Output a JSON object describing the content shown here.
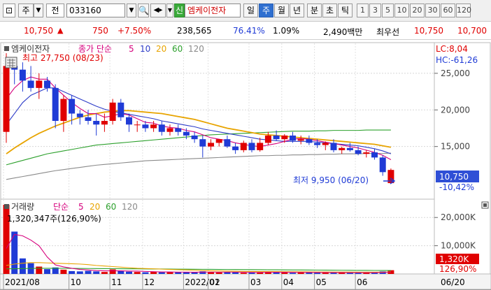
{
  "toolbar": {
    "type_label": "주",
    "field_label": "전",
    "code": "033160",
    "stock_name": "엠케이전자",
    "credit_label": "신",
    "periods": [
      "일",
      "주",
      "월",
      "년",
      "분",
      "초",
      "틱"
    ],
    "active_period": "주",
    "intervals": [
      "1",
      "3",
      "5",
      "10",
      "20",
      "30",
      "60",
      "120"
    ]
  },
  "quote": {
    "price": "10,750",
    "change": "750",
    "change_pct": "+7.50%",
    "volume": "238,565",
    "vol_ratio": "76.41%",
    "turnover": "1.09%",
    "amount": "2,490백만",
    "preferred_label": "최우선",
    "ask": "10,750",
    "bid": "10,700"
  },
  "colors": {
    "up": "#e00000",
    "down": "#1f3bd6",
    "ma5": "#d6007c",
    "ma10": "#2d3cc8",
    "ma20": "#e8a400",
    "ma60": "#2ca02c",
    "ma120": "#8a8a8a",
    "vol_up": "#e00000",
    "vol_down": "#1f3bd6"
  },
  "price_panel": {
    "legend_name": "엠케이전자",
    "legend_series": [
      "종가 단순",
      "5",
      "10",
      "20",
      "60",
      "120"
    ],
    "high_label": "최고 27,750 (08/23)",
    "low_label": "최저 9,950 (06/20)",
    "lc_label": "LC:8,04",
    "hc_label": "HC:-61,26",
    "axis_ticks": [
      "25,000",
      "20,000",
      "15,000"
    ],
    "last_price": "10,750",
    "last_change": "-10,42%"
  },
  "volume_panel": {
    "legend_title": "거래량",
    "legend_series": [
      "단순",
      "5",
      "20",
      "60",
      "120"
    ],
    "last_label": "1,320,347주(126,90%)",
    "axis_ticks": [
      "20,000K",
      "10,000K"
    ],
    "last_value": "1,320K",
    "last_pct": "126,90%"
  },
  "x_axis": {
    "labels": [
      "2021/08",
      "10",
      "11",
      "12",
      "2022/01",
      "02",
      "03",
      "04",
      "05",
      "06"
    ],
    "cursor_label": "06/20"
  },
  "chart_data": {
    "type": "candlestick",
    "period": "weekly",
    "price_ylim": [
      8000,
      29000
    ],
    "candles": [
      {
        "o": 17000,
        "h": 27750,
        "l": 15500,
        "c": 26000
      },
      {
        "o": 26000,
        "h": 27200,
        "l": 23500,
        "c": 25500
      },
      {
        "o": 25500,
        "h": 26500,
        "l": 22500,
        "c": 24000
      },
      {
        "o": 24000,
        "h": 26000,
        "l": 22500,
        "c": 23000
      },
      {
        "o": 23000,
        "h": 25000,
        "l": 21500,
        "c": 24000
      },
      {
        "o": 24000,
        "h": 24500,
        "l": 22500,
        "c": 23000
      },
      {
        "o": 23000,
        "h": 23500,
        "l": 17500,
        "c": 18500
      },
      {
        "o": 18500,
        "h": 22000,
        "l": 17000,
        "c": 21500
      },
      {
        "o": 21500,
        "h": 22000,
        "l": 18000,
        "c": 19500
      },
      {
        "o": 19500,
        "h": 20000,
        "l": 18000,
        "c": 19000
      },
      {
        "o": 19000,
        "h": 20000,
        "l": 18000,
        "c": 18500
      },
      {
        "o": 18500,
        "h": 19500,
        "l": 16500,
        "c": 18000
      },
      {
        "o": 18000,
        "h": 19500,
        "l": 17000,
        "c": 18500
      },
      {
        "o": 18500,
        "h": 21500,
        "l": 18000,
        "c": 21000
      },
      {
        "o": 21000,
        "h": 21500,
        "l": 18500,
        "c": 19000
      },
      {
        "o": 19000,
        "h": 19500,
        "l": 17000,
        "c": 18000
      },
      {
        "o": 18000,
        "h": 18500,
        "l": 17000,
        "c": 18000
      },
      {
        "o": 18000,
        "h": 18500,
        "l": 17000,
        "c": 17500
      },
      {
        "o": 17500,
        "h": 18500,
        "l": 17000,
        "c": 18000
      },
      {
        "o": 18000,
        "h": 18500,
        "l": 16500,
        "c": 17000
      },
      {
        "o": 17000,
        "h": 18000,
        "l": 16500,
        "c": 17500
      },
      {
        "o": 17500,
        "h": 18000,
        "l": 16500,
        "c": 17000
      },
      {
        "o": 17000,
        "h": 17500,
        "l": 16000,
        "c": 16500
      },
      {
        "o": 16500,
        "h": 17000,
        "l": 15500,
        "c": 16000
      },
      {
        "o": 16000,
        "h": 16500,
        "l": 13500,
        "c": 15000
      },
      {
        "o": 15000,
        "h": 16000,
        "l": 14500,
        "c": 15500
      },
      {
        "o": 15500,
        "h": 16000,
        "l": 15000,
        "c": 16000
      },
      {
        "o": 16000,
        "h": 16500,
        "l": 14800,
        "c": 15000
      },
      {
        "o": 15000,
        "h": 15500,
        "l": 14000,
        "c": 14500
      },
      {
        "o": 14500,
        "h": 15800,
        "l": 14200,
        "c": 15500
      },
      {
        "o": 15500,
        "h": 16000,
        "l": 14200,
        "c": 14500
      },
      {
        "o": 14500,
        "h": 16200,
        "l": 14300,
        "c": 15500
      },
      {
        "o": 15500,
        "h": 17000,
        "l": 15200,
        "c": 16500
      },
      {
        "o": 16500,
        "h": 17200,
        "l": 15800,
        "c": 16000
      },
      {
        "o": 16000,
        "h": 16700,
        "l": 15500,
        "c": 16500
      },
      {
        "o": 16500,
        "h": 17000,
        "l": 15500,
        "c": 15800
      },
      {
        "o": 15800,
        "h": 16500,
        "l": 15300,
        "c": 16000
      },
      {
        "o": 16000,
        "h": 16500,
        "l": 15200,
        "c": 15500
      },
      {
        "o": 15500,
        "h": 16000,
        "l": 14800,
        "c": 15200
      },
      {
        "o": 15200,
        "h": 15700,
        "l": 14500,
        "c": 15500
      },
      {
        "o": 15500,
        "h": 16000,
        "l": 14200,
        "c": 14500
      },
      {
        "o": 14500,
        "h": 15000,
        "l": 14000,
        "c": 14800
      },
      {
        "o": 14800,
        "h": 15500,
        "l": 14300,
        "c": 14500
      },
      {
        "o": 14500,
        "h": 15000,
        "l": 13800,
        "c": 14000
      },
      {
        "o": 14000,
        "h": 14500,
        "l": 13500,
        "c": 14200
      },
      {
        "o": 14200,
        "h": 14700,
        "l": 13200,
        "c": 13500
      },
      {
        "o": 13500,
        "h": 13800,
        "l": 11000,
        "c": 11500
      },
      {
        "o": 10000,
        "h": 12000,
        "l": 9950,
        "c": 11800
      }
    ],
    "ma5": [
      21500,
      23000,
      24000,
      24500,
      24200,
      24200,
      23000,
      22000,
      21000,
      20200,
      19500,
      19500,
      19000,
      19200,
      19500,
      19300,
      18800,
      18300,
      18200,
      17800,
      17600,
      17500,
      17200,
      17000,
      16600,
      16200,
      16000,
      15800,
      15500,
      15300,
      15100,
      15000,
      15200,
      15400,
      15700,
      16000,
      16100,
      16000,
      15800,
      15600,
      15400,
      15200,
      15000,
      14800,
      14500,
      14200,
      13800,
      13200
    ],
    "ma10": [
      18000,
      19500,
      21000,
      22000,
      22500,
      23000,
      23000,
      22500,
      22000,
      21500,
      21000,
      20500,
      20100,
      19800,
      19600,
      19400,
      19200,
      19000,
      18800,
      18500,
      18300,
      18100,
      17900,
      17700,
      17400,
      17200,
      17000,
      16800,
      16600,
      16400,
      16200,
      16000,
      15900,
      15800,
      15700,
      15700,
      15700,
      15700,
      15600,
      15500,
      15400,
      15300,
      15200,
      15100,
      14900,
      14700,
      14400,
      14000
    ],
    "ma20": [
      14000,
      14800,
      15500,
      16200,
      16800,
      17300,
      17800,
      18200,
      18600,
      19000,
      19300,
      19500,
      19700,
      19800,
      19900,
      19900,
      19800,
      19700,
      19600,
      19500,
      19300,
      19100,
      18900,
      18700,
      18400,
      18100,
      17800,
      17500,
      17300,
      17100,
      16900,
      16700,
      16600,
      16500,
      16400,
      16300,
      16200,
      16100,
      16000,
      15900,
      15800,
      15700,
      15600,
      15500,
      15400,
      15300,
      15100,
      14900
    ],
    "ma60": [
      12500,
      12800,
      13100,
      13400,
      13700,
      14000,
      14200,
      14400,
      14600,
      14800,
      15000,
      15200,
      15300,
      15400,
      15500,
      15600,
      15700,
      15800,
      15900,
      16000,
      16100,
      16200,
      16300,
      16400,
      16500,
      16600,
      16650,
      16700,
      16750,
      16800,
      16850,
      16900,
      16950,
      17000,
      17050,
      17100,
      17100,
      17100,
      17150,
      17150,
      17200,
      17200,
      17200,
      17200,
      17250,
      17250,
      17250,
      17250
    ],
    "ma120": [
      10500,
      10700,
      10900,
      11100,
      11300,
      11500,
      11700,
      11850,
      12000,
      12150,
      12300,
      12450,
      12550,
      12650,
      12750,
      12850,
      12950,
      13050,
      13100,
      13150,
      13200,
      13250,
      13300,
      13350,
      13400,
      13450,
      13500,
      13550,
      13600,
      13650,
      13700,
      13750,
      13750,
      13800,
      13800,
      13850,
      13850,
      13900,
      13900,
      13950,
      13950,
      14000,
      14000,
      14000,
      14050,
      14050,
      14050,
      14100
    ],
    "volume_ylim": [
      0,
      26000
    ],
    "volume": [
      24500,
      15000,
      5500,
      3800,
      2600,
      1700,
      2300,
      1500,
      1000,
      900,
      1100,
      900,
      700,
      1600,
      1100,
      800,
      700,
      600,
      800,
      600,
      700,
      600,
      700,
      500,
      900,
      600,
      500,
      700,
      600,
      400,
      500,
      500,
      900,
      600,
      500,
      400,
      500,
      500,
      400,
      500,
      500,
      400,
      400,
      500,
      400,
      500,
      900,
      1320
    ],
    "vol_ma5": [
      9000,
      14000,
      13500,
      12000,
      10000,
      6000,
      3200,
      2500,
      2000,
      1600,
      1400,
      1200,
      1100,
      1100,
      1100,
      1000,
      1000,
      900,
      800,
      700,
      700,
      650,
      650,
      600,
      650,
      650,
      650,
      650,
      650,
      600,
      550,
      550,
      600,
      600,
      600,
      580,
      560,
      540,
      520,
      500,
      480,
      470,
      460,
      450,
      440,
      460,
      500,
      650
    ],
    "vol_ma20": [
      3000,
      3500,
      3800,
      4000,
      4000,
      3900,
      3800,
      3700,
      3600,
      3500,
      3300,
      3000,
      2800,
      2600,
      2400,
      2200,
      2000,
      1900,
      1800,
      1700,
      1600,
      1500,
      1400,
      1300,
      1200,
      1100,
      1050,
      1000,
      950,
      900,
      870,
      850,
      830,
      810,
      790,
      770,
      750,
      730,
      710,
      690,
      680,
      670,
      660,
      650,
      640,
      640,
      650,
      700
    ],
    "vol_ma60": [
      1800,
      1850,
      1900,
      1950,
      2000,
      2000,
      2000,
      1980,
      1960,
      1940,
      1920,
      1900,
      1880,
      1860,
      1840,
      1820,
      1800,
      1780,
      1760,
      1740,
      1720,
      1700,
      1680,
      1660,
      1640,
      1620,
      1600,
      1580,
      1560,
      1540,
      1520,
      1500,
      1480,
      1460,
      1440,
      1420,
      1400,
      1380,
      1360,
      1340,
      1320,
      1300,
      1280,
      1260,
      1250,
      1240,
      1230,
      1220
    ],
    "x_tick_index": [
      0,
      8,
      13,
      17,
      22,
      25,
      30,
      34,
      38,
      43
    ],
    "cursor_index": 47,
    "high_index": 0,
    "low_index": 47
  }
}
